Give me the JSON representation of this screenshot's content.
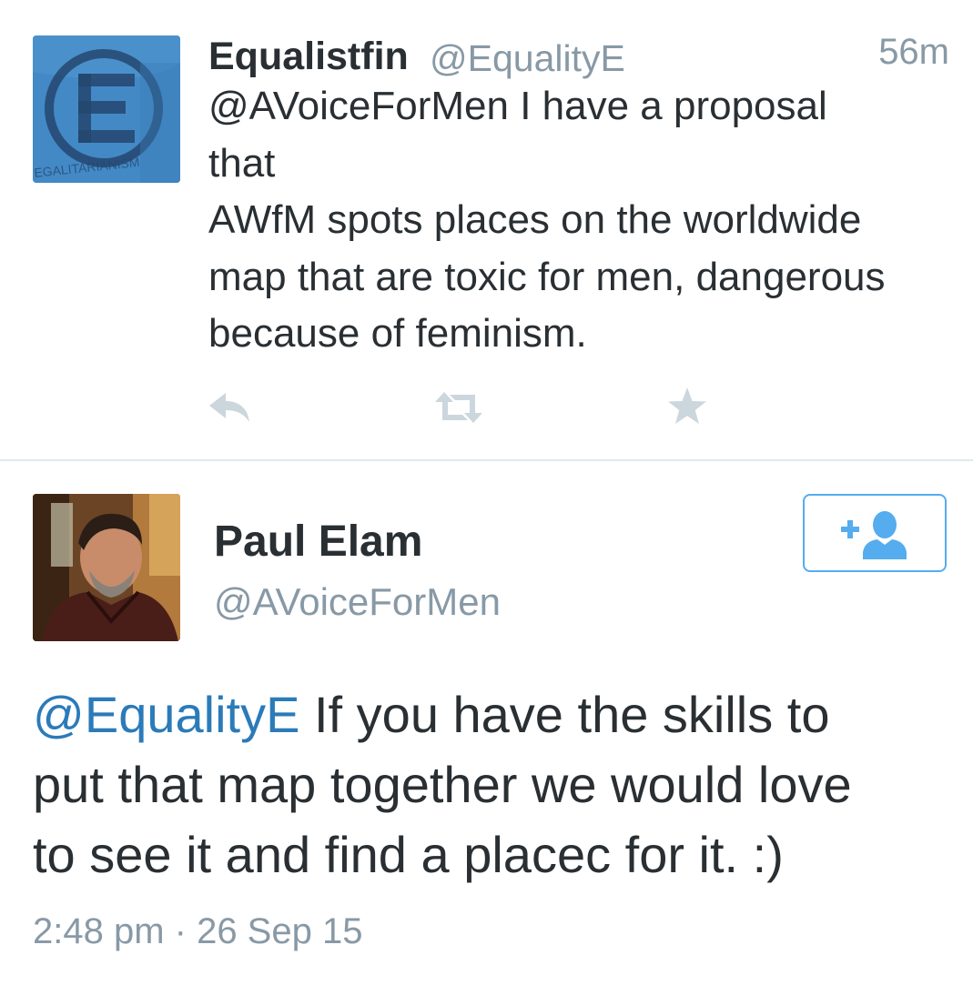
{
  "tweet1": {
    "author_name": "Equalistfin",
    "author_handle": "@EqualityE",
    "avatar_text": "EGALITARIANISM",
    "time": "56m",
    "text_lines": [
      "@AVoiceForMen I have a proposal",
      "that",
      "AWfM spots places on the worldwide",
      "map that are toxic for men, dangerous",
      "because of feminism."
    ],
    "actions": [
      "reply-icon",
      "retweet-icon",
      "favorite-icon"
    ]
  },
  "tweet2": {
    "author_name": "Paul Elam",
    "author_handle": "@AVoiceForMen",
    "follow_icon": "add-user-icon",
    "mention": "@EqualityE",
    "text_lines": [
      " If you have the skills to",
      "put that map together we would love",
      "to see it and find a placec for it. :)"
    ],
    "meta": "2:48 pm · 26 Sep 15"
  },
  "colors": {
    "text": "#292f33",
    "secondary": "#8899a6",
    "link": "#2b7bb9",
    "accent": "#55acee",
    "action_icon": "#ccd6dd",
    "divider": "#e1e8ed"
  }
}
